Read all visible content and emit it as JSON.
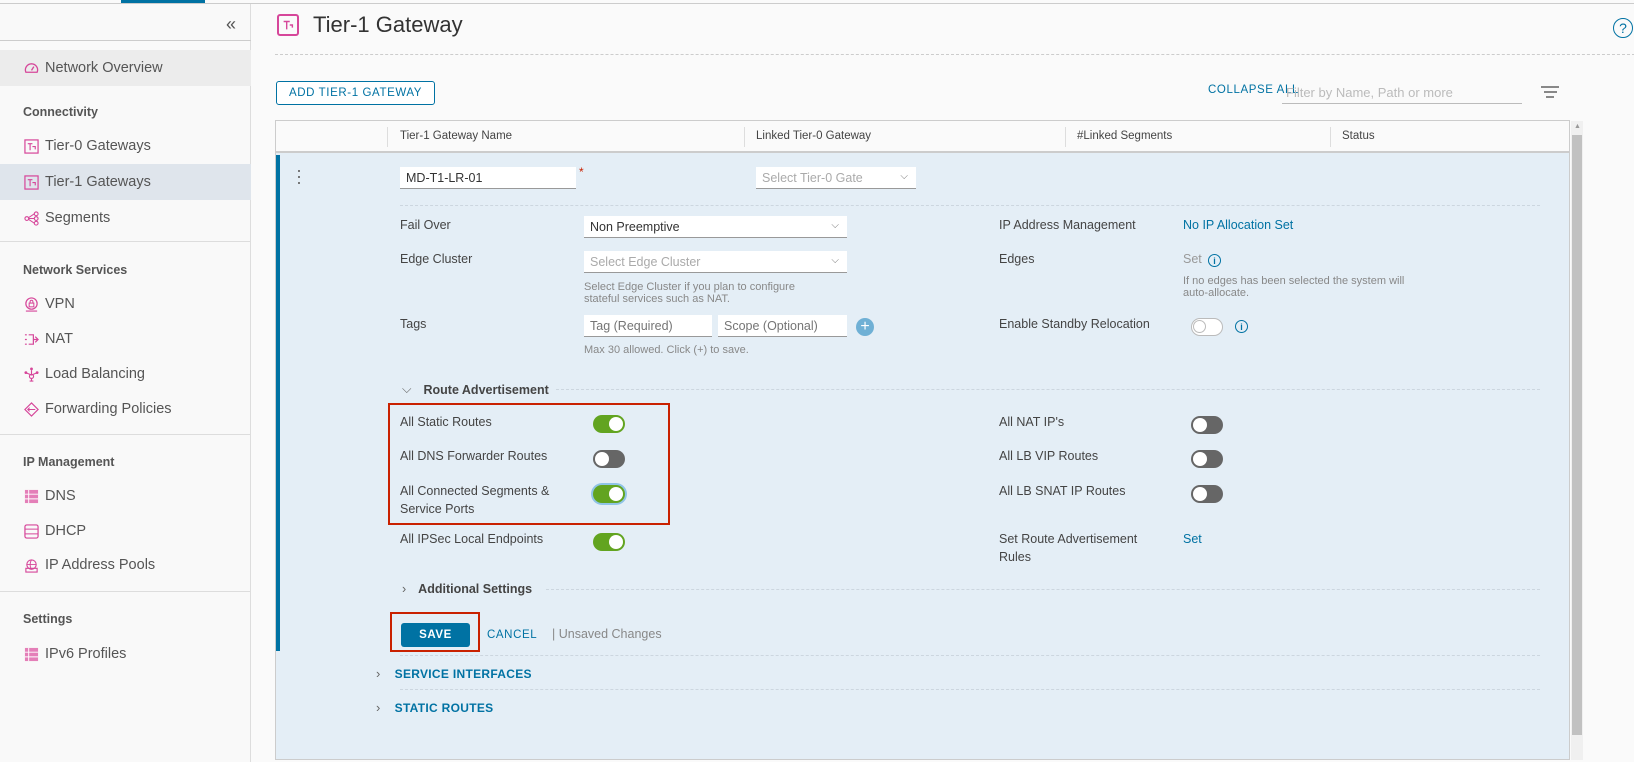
{
  "sidebar": {
    "collapse_icon": "double-chevron-left",
    "overview": {
      "label": "Network Overview",
      "icon": "gauge-icon"
    },
    "groups": [
      {
        "heading": "Connectivity",
        "items": [
          {
            "label": "Tier-0 Gateways",
            "icon": "gateway-icon"
          },
          {
            "label": "Tier-1 Gateways",
            "icon": "gateway-icon",
            "active": true
          },
          {
            "label": "Segments",
            "icon": "segments-icon"
          }
        ]
      },
      {
        "heading": "Network Services",
        "items": [
          {
            "label": "VPN",
            "icon": "vpn-lock-icon"
          },
          {
            "label": "NAT",
            "icon": "nat-icon"
          },
          {
            "label": "Load Balancing",
            "icon": "load-balancer-icon"
          },
          {
            "label": "Forwarding Policies",
            "icon": "forwarding-icon"
          }
        ]
      },
      {
        "heading": "IP Management",
        "items": [
          {
            "label": "DNS",
            "icon": "dns-icon"
          },
          {
            "label": "DHCP",
            "icon": "dhcp-icon"
          },
          {
            "label": "IP Address Pools",
            "icon": "ip-pool-icon"
          }
        ]
      },
      {
        "heading": "Settings",
        "items": [
          {
            "label": "IPv6 Profiles",
            "icon": "profile-icon"
          }
        ]
      }
    ]
  },
  "header": {
    "title": "Tier-1 Gateway",
    "help": "?",
    "add_button": "ADD TIER-1 GATEWAY",
    "collapse_all": "COLLAPSE ALL",
    "filter_placeholder": "Filter by Name, Path or more"
  },
  "grid": {
    "columns": [
      "Tier-1 Gateway Name",
      "Linked Tier-0 Gateway",
      "#Linked Segments",
      "Status"
    ],
    "row": {
      "name_value": "MD-T1-LR-01",
      "required_mark": "*",
      "tier0_placeholder": "Select Tier-0 Gate",
      "fail_over": {
        "label": "Fail Over",
        "value": "Non Preemptive"
      },
      "edge_cluster": {
        "label": "Edge Cluster",
        "placeholder": "Select Edge Cluster",
        "hint_1": "Select Edge Cluster if you plan to configure",
        "hint_2": "stateful services such as NAT."
      },
      "tags": {
        "label": "Tags",
        "tag_placeholder": "Tag (Required)",
        "scope_placeholder": "Scope (Optional)",
        "hint": "Max 30 allowed. Click (+) to save.",
        "plus": "+"
      },
      "ip_mgmt": {
        "label": "IP Address Management",
        "value": "No IP Allocation Set"
      },
      "edges": {
        "label": "Edges",
        "value": "Set",
        "hint_1": "If no edges has been selected the system will",
        "hint_2": "auto-allocate."
      },
      "standby": {
        "label": "Enable Standby Relocation",
        "enabled": false
      },
      "route_adv": {
        "title": "Route Advertisement",
        "left": [
          {
            "label": "All Static Routes",
            "on": true
          },
          {
            "label": "All DNS Forwarder Routes",
            "on": false
          },
          {
            "label_1": "All Connected Segments &",
            "label_2": "Service Ports",
            "on": true
          },
          {
            "label": "All IPSec Local Endpoints",
            "on": true
          }
        ],
        "right": [
          {
            "label": "All NAT IP's",
            "on": false
          },
          {
            "label": "All LB VIP Routes",
            "on": false
          },
          {
            "label": "All LB SNAT IP Routes",
            "on": false
          }
        ],
        "rules_label_1": "Set Route Advertisement",
        "rules_label_2": "Rules",
        "rules_link": "Set"
      },
      "additional": "Additional Settings",
      "save": "SAVE",
      "cancel": "CANCEL",
      "unsaved": "| Unsaved Changes"
    },
    "subsections": [
      "SERVICE INTERFACES",
      "STATIC ROUTES"
    ]
  },
  "colors": {
    "accent": "#0072a3",
    "icon": "#d6479a",
    "toggle_on": "#62a420",
    "toggle_off": "#666666",
    "highlight": "#c92100"
  }
}
